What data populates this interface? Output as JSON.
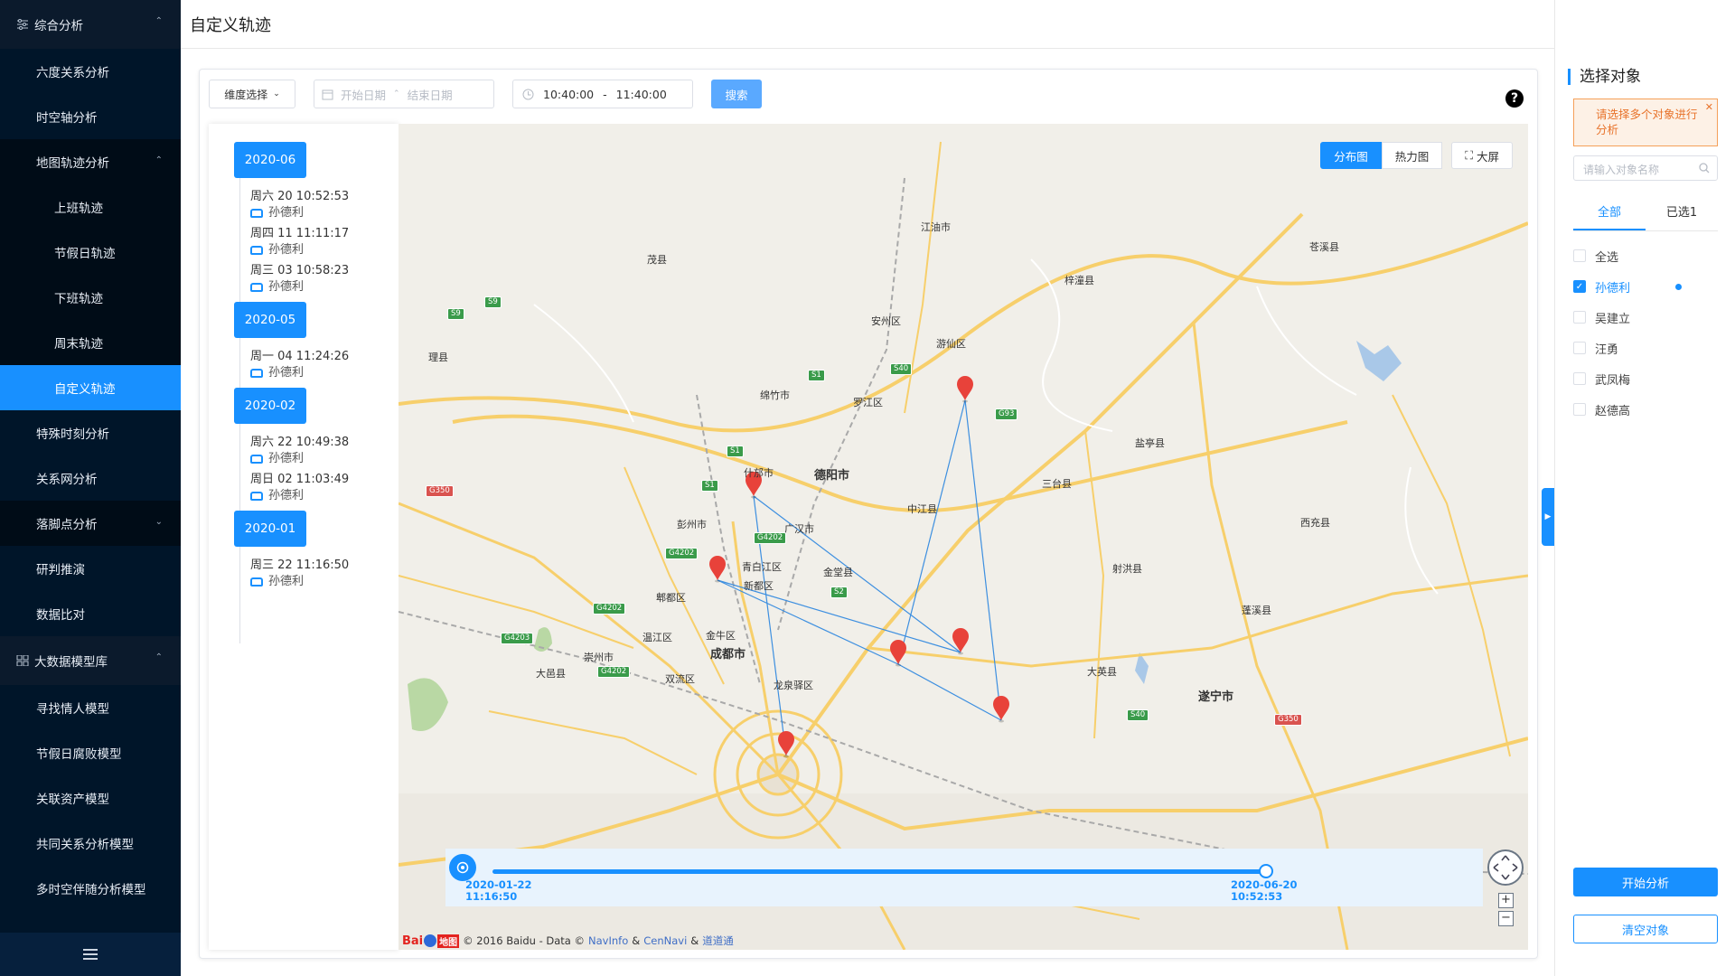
{
  "sidebar": {
    "items": [
      {
        "label": "综合分析",
        "type": "group",
        "expanded": true
      },
      {
        "label": "六度关系分析",
        "type": "item"
      },
      {
        "label": "时空轴分析",
        "type": "item"
      },
      {
        "label": "地图轨迹分析",
        "type": "group-sub",
        "expanded": true
      },
      {
        "label": "上班轨迹",
        "type": "sub"
      },
      {
        "label": "节假日轨迹",
        "type": "sub"
      },
      {
        "label": "下班轨迹",
        "type": "sub"
      },
      {
        "label": "周末轨迹",
        "type": "sub"
      },
      {
        "label": "自定义轨迹",
        "type": "sub",
        "active": true
      },
      {
        "label": "特殊时刻分析",
        "type": "item"
      },
      {
        "label": "关系网分析",
        "type": "item"
      },
      {
        "label": "落脚点分析",
        "type": "group-sub",
        "expanded": false
      },
      {
        "label": "研判推演",
        "type": "item"
      },
      {
        "label": "数据比对",
        "type": "item"
      },
      {
        "label": "大数据模型库",
        "type": "group",
        "expanded": true
      },
      {
        "label": "寻找情人模型",
        "type": "item"
      },
      {
        "label": "节假日腐败模型",
        "type": "item"
      },
      {
        "label": "关联资产模型",
        "type": "item"
      },
      {
        "label": "共同关系分析模型",
        "type": "item"
      },
      {
        "label": "多时空伴随分析模型",
        "type": "item"
      }
    ]
  },
  "header": {
    "title": "自定义轨迹"
  },
  "filters": {
    "dimension_label": "维度选择",
    "start_placeholder": "开始日期",
    "end_placeholder": "结束日期",
    "time_start": "10:40:00",
    "time_sep": "-",
    "time_end": "11:40:00",
    "search_label": "搜索"
  },
  "timeline": [
    {
      "month": "2020-06",
      "entries": [
        {
          "time": "周六 20 10:52:53",
          "name": "孙德利"
        },
        {
          "time": "周四 11 11:11:17",
          "name": "孙德利"
        },
        {
          "time": "周三 03 10:58:23",
          "name": "孙德利"
        }
      ]
    },
    {
      "month": "2020-05",
      "entries": [
        {
          "time": "周一 04 11:24:26",
          "name": "孙德利"
        }
      ]
    },
    {
      "month": "2020-02",
      "entries": [
        {
          "time": "周六 22 10:49:38",
          "name": "孙德利"
        },
        {
          "time": "周日 02 11:03:49",
          "name": "孙德利"
        }
      ]
    },
    {
      "month": "2020-01",
      "entries": [
        {
          "time": "周三 22 11:16:50",
          "name": "孙德利"
        }
      ]
    }
  ],
  "map": {
    "buttons": {
      "distribution": "分布图",
      "heatmap": "热力图",
      "fullscreen": "大屏"
    },
    "labels": [
      "江油市",
      "茂县",
      "梓潼县",
      "苍溪县",
      "安州区",
      "游仙区",
      "理县",
      "绵竹市",
      "罗江区",
      "盐亭县",
      "什邡市",
      "德阳市",
      "中江县",
      "三台县",
      "彭州市",
      "广汉市",
      "西充县",
      "青白江区",
      "金堂县",
      "射洪县",
      "新都区",
      "郫都区",
      "蓬溪县",
      "金牛区",
      "温江区",
      "成都市",
      "崇州市",
      "大英县",
      "双流区",
      "大邑县",
      "龙泉驿区",
      "遂宁市"
    ],
    "city_labels": [
      "德阳市",
      "成都市",
      "遂宁市"
    ],
    "shields": [
      "S9",
      "S9",
      "S1",
      "S40",
      "G93",
      "S1",
      "S1",
      "G350",
      "G4202",
      "G4202",
      "G4202",
      "S2",
      "G4203",
      "G4202",
      "S40",
      "G350"
    ],
    "copyright": "© 2016 Baidu - Data ©",
    "copyright_links": [
      "NavInfo",
      "CenNavi",
      "道道通"
    ],
    "copyright_amp": "&",
    "baidu_logo": "Baidu 地图",
    "player": {
      "start_date": "2020-01-22",
      "start_time": "11:16:50",
      "end_date": "2020-06-20",
      "end_time": "10:52:53",
      "progress": 1.0
    },
    "zoom_in": "+",
    "zoom_out": "−"
  },
  "right_panel": {
    "title": "选择对象",
    "warning": "请选择多个对象进行分析",
    "search_placeholder": "请输入对象名称",
    "tabs": [
      "全部",
      "已选1"
    ],
    "select_all": "全选",
    "objects": [
      {
        "name": "孙德利",
        "checked": true
      },
      {
        "name": "吴建立",
        "checked": false
      },
      {
        "name": "汪勇",
        "checked": false
      },
      {
        "name": "武凤梅",
        "checked": false
      },
      {
        "name": "赵德高",
        "checked": false
      }
    ],
    "start_label": "开始分析",
    "clear_label": "清空对象"
  },
  "colors": {
    "accent": "#1890ff",
    "sidebar": "#001529",
    "marker": "#e8423a",
    "route": "#3d8fe0",
    "warn": "#e8732b"
  }
}
